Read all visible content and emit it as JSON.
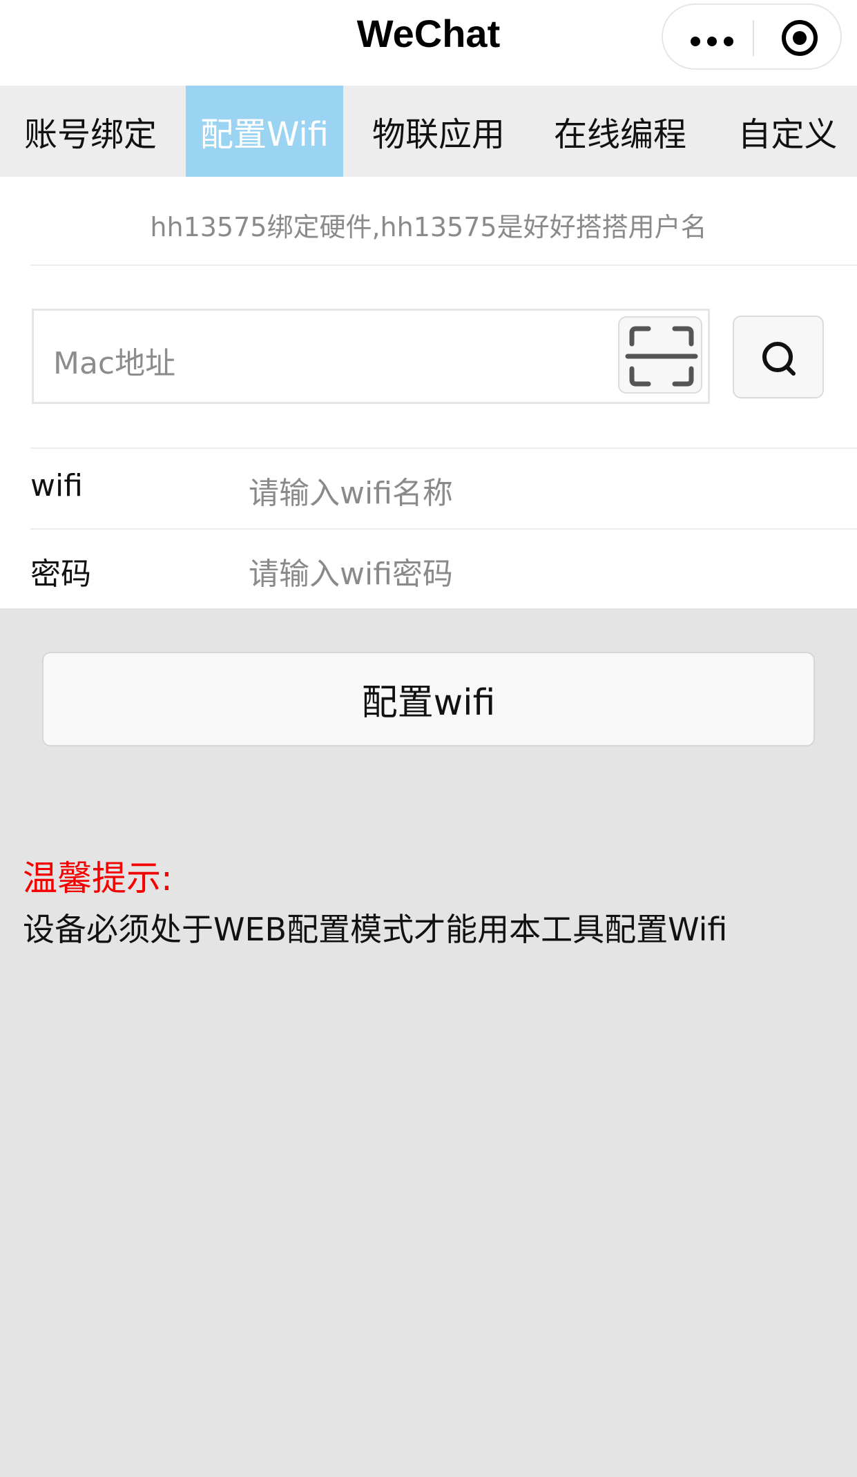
{
  "navbar": {
    "title": "WeChat",
    "more_icon": "more-dots-icon",
    "close_icon": "target-circle-icon"
  },
  "tabs": [
    {
      "label": "账号绑定",
      "active": false
    },
    {
      "label": "配置Wifi",
      "active": true
    },
    {
      "label": "物联应用",
      "active": false
    },
    {
      "label": "在线编程",
      "active": false
    },
    {
      "label": "自定义",
      "active": false
    }
  ],
  "hint": "hh13575绑定硬件,hh13575是好好搭搭用户名",
  "mac": {
    "placeholder": "Mac地址",
    "scan_icon": "scan-icon",
    "search_icon": "search-icon"
  },
  "form": {
    "wifi_label": "wifi",
    "wifi_placeholder": "请输入wifi名称",
    "password_label": "密码",
    "password_placeholder": "请输入wifi密码"
  },
  "config_button": "配置wifi",
  "tips": {
    "title": "温馨提示:",
    "text": "设备必须处于WEB配置模式才能用本工具配置Wifi"
  },
  "colors": {
    "active_tab": "#9bd3f2",
    "tip_title": "#f50000",
    "page_bg": "#e4e4e4",
    "tabbar_bg": "#ededed"
  }
}
